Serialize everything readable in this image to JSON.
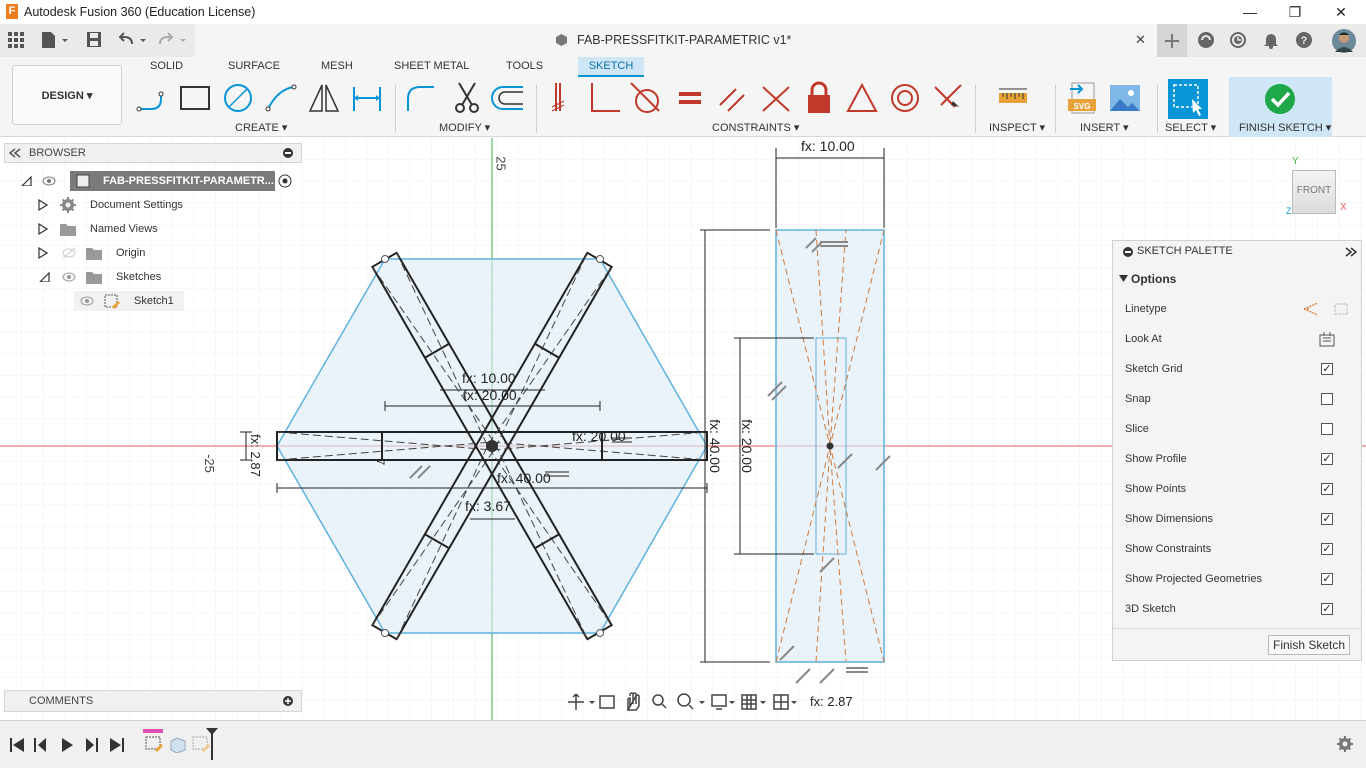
{
  "app": {
    "logo": "F",
    "title": "Autodesk Fusion 360 (Education License)"
  },
  "window_controls": {
    "minimize": "—",
    "maximize": "❐",
    "close": "✕"
  },
  "document": {
    "title": "FAB-PRESSFITKIT-PARAMETRIC v1*",
    "close": "✕"
  },
  "ribbon": {
    "workspace": "DESIGN ▾",
    "tabs": [
      "SOLID",
      "SURFACE",
      "MESH",
      "SHEET METAL",
      "TOOLS",
      "SKETCH"
    ],
    "active_tab": "SKETCH",
    "groups": {
      "create": "CREATE ▾",
      "modify": "MODIFY ▾",
      "constraints": "CONSTRAINTS ▾",
      "inspect": "INSPECT ▾",
      "insert": "INSERT ▾",
      "select": "SELECT ▾",
      "finish": "FINISH SKETCH ▾"
    }
  },
  "browser": {
    "title": "BROWSER",
    "root": "FAB-PRESSFITKIT-PARAMETR...",
    "items": [
      {
        "label": "Document Settings"
      },
      {
        "label": "Named Views"
      },
      {
        "label": "Origin"
      },
      {
        "label": "Sketches"
      },
      {
        "label": "Sketch1"
      }
    ]
  },
  "comments": {
    "title": "COMMENTS"
  },
  "canvas": {
    "axis_labels": {
      "top": "25",
      "left": "-25"
    },
    "dimensions": {
      "top_width": "fx: 10.00",
      "right_height": "fx: 40.00",
      "right_inner": "fx: 20.00",
      "bottom": "fx: 2.87",
      "hex_10": "fx: 10.00",
      "hex_20": "fx: 20.00",
      "hex_20b": "fx: 20.00",
      "hex_40": "fx: 40.00",
      "hex_287": "fx: 2.87",
      "hex_367": "fx: 3.67",
      "hex_inner": "7"
    },
    "viewcube": {
      "label": "FRONT",
      "y_axis": "Y",
      "x_axis": "X",
      "z_axis": "Z"
    }
  },
  "palette": {
    "title": "SKETCH PALETTE",
    "section": "Options",
    "rows": [
      {
        "label": "Linetype"
      },
      {
        "label": "Look At"
      },
      {
        "label": "Sketch Grid",
        "checked": true
      },
      {
        "label": "Snap",
        "checked": false
      },
      {
        "label": "Slice",
        "checked": false
      },
      {
        "label": "Show Profile",
        "checked": true
      },
      {
        "label": "Show Points",
        "checked": true
      },
      {
        "label": "Show Dimensions",
        "checked": true
      },
      {
        "label": "Show Constraints",
        "checked": true
      },
      {
        "label": "Show Projected Geometries",
        "checked": true
      },
      {
        "label": "3D Sketch",
        "checked": true
      }
    ],
    "finish_button": "Finish Sketch"
  },
  "colors": {
    "accent_blue": "#0696d7",
    "profile_fill": "#dcebf7",
    "profile_stroke": "#5fb2e0",
    "finish_green": "#1ea84a",
    "sketch_tab": "#cfe6f6",
    "axis_red": "#e06060",
    "axis_green": "#3fb04a"
  }
}
